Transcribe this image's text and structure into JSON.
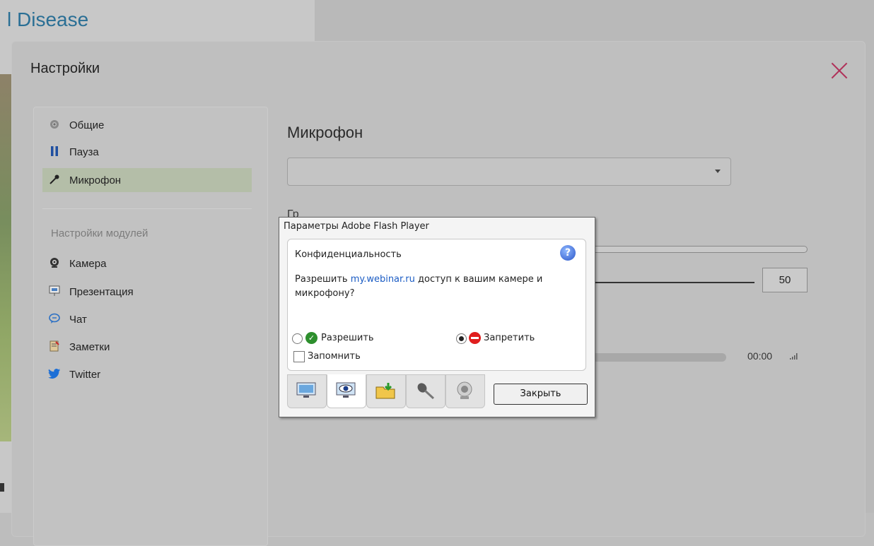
{
  "background": {
    "title": "l Disease"
  },
  "modal": {
    "title": "Настройки",
    "close_icon": "close-icon",
    "sidebar": {
      "items": [
        {
          "label": "Общие",
          "icon": "gear-icon"
        },
        {
          "label": "Пауза",
          "icon": "pause-icon"
        },
        {
          "label": "Микрофон",
          "icon": "microphone-icon",
          "active": true
        }
      ],
      "modules_label": "Настройки модулей",
      "modules": [
        {
          "label": "Камера",
          "icon": "camera-icon"
        },
        {
          "label": "Презентация",
          "icon": "presentation-icon"
        },
        {
          "label": "Чат",
          "icon": "chat-icon"
        },
        {
          "label": "Заметки",
          "icon": "notes-icon"
        },
        {
          "label": "Twitter",
          "icon": "twitter-icon"
        }
      ]
    },
    "main": {
      "title": "Микрофон",
      "device_select_value": "",
      "partial_label": "Гр",
      "volume_value": "50",
      "time": "00:00"
    }
  },
  "flash_dialog": {
    "title": "Параметры Adobe Flash Player",
    "heading": "Конфиденциальность",
    "text_before": "Разрешить ",
    "link": "my.webinar.ru",
    "text_after": " доступ к вашим камере и микрофону?",
    "allow_label": "Разрешить",
    "deny_label": "Запретить",
    "selected": "deny",
    "remember_label": "Запомнить",
    "close_label": "Закрыть",
    "tabs": [
      "display-tab-icon",
      "privacy-tab-icon",
      "storage-tab-icon",
      "microphone-tab-icon",
      "camera-tab-icon"
    ]
  },
  "colors": {
    "accent_link": "#1b5cc4",
    "close_x": "#b0325a",
    "allow_green": "#2d8f2d",
    "deny_red": "#e01e1e"
  }
}
